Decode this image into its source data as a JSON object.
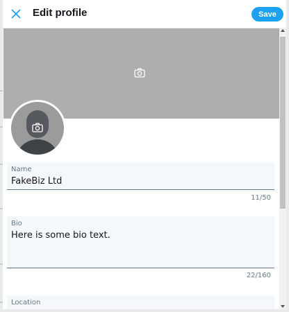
{
  "dialog": {
    "title": "Edit profile",
    "close_icon": "close-icon",
    "save_label": "Save",
    "accent_color": "#1da1f2"
  },
  "banner": {
    "camera_icon": "camera-icon",
    "color": "#aeaeae"
  },
  "avatar": {
    "camera_icon": "camera-icon",
    "placeholder_icon": "user-silhouette-icon"
  },
  "fields": {
    "name": {
      "label": "Name",
      "value": "FakeBiz Ltd",
      "counter": "11/50"
    },
    "bio": {
      "label": "Bio",
      "value": "Here is some bio text.",
      "counter": "22/160"
    },
    "location": {
      "label": "Location",
      "value": ""
    }
  },
  "scroll": {
    "position": 0.0
  }
}
